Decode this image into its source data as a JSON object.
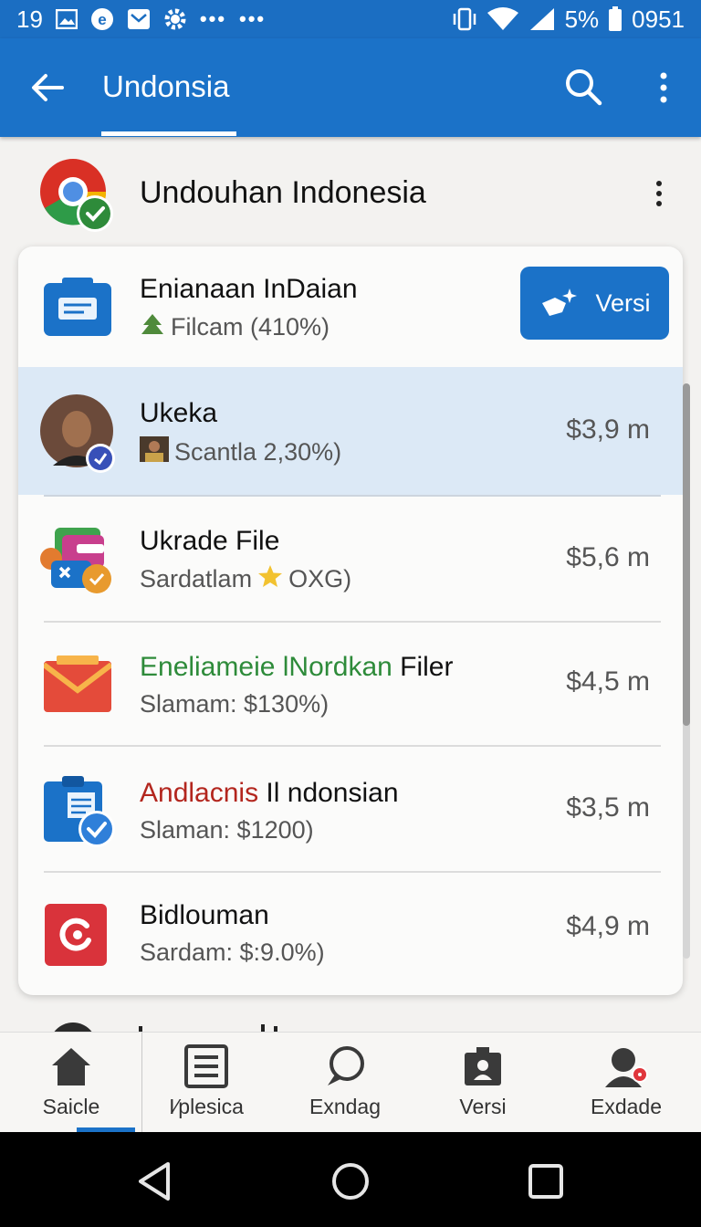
{
  "status_bar": {
    "time_left": "19",
    "battery_pct": "5%",
    "clock": "0951",
    "dots_a": "•••",
    "dots_b": "•••"
  },
  "app_bar": {
    "title": "Undonsia",
    "back_icon": "arrow-left-icon",
    "search_icon": "search-icon",
    "more_icon": "more-vert-icon"
  },
  "header": {
    "title": "Undouhan Indonesia"
  },
  "items": [
    {
      "name": "Enianaan InDaian",
      "sub": "Filcam (410%)",
      "action_label": "Versi"
    },
    {
      "name": "Ukeka",
      "sub": "Scantla 2,30%)",
      "price": "$3,9 m"
    },
    {
      "name": "Ukrade File",
      "sub_a": "Sardatlam",
      "sub_b": "OXG)",
      "price": "$5,6 m"
    },
    {
      "name_a": "Eneliameie lNordkan",
      "name_b": "Filer",
      "sub": "Slamam: $130%)",
      "price": "$4,5 m"
    },
    {
      "name_a": "Andlacnis",
      "name_b": "Il ndonsian",
      "sub": "Slaman: $1200)",
      "price": "$3,5 m"
    },
    {
      "name": "Bidlouman",
      "sub": "Sardam: $:9.0%)",
      "price": "$4,9 m"
    }
  ],
  "bottom_nav": [
    {
      "label": "Saicle",
      "icon": "home-icon"
    },
    {
      "label": "I⁄plesica",
      "icon": "list-icon"
    },
    {
      "label": "Exndag",
      "icon": "chat-icon"
    },
    {
      "label": "Versi",
      "icon": "badge-icon"
    },
    {
      "label": "Exdade",
      "icon": "profile-icon"
    }
  ],
  "colors": {
    "primary": "#1b72c8",
    "selected_row": "#dce9f6",
    "green_text": "#2e8b3a",
    "red_text": "#b3261e"
  }
}
